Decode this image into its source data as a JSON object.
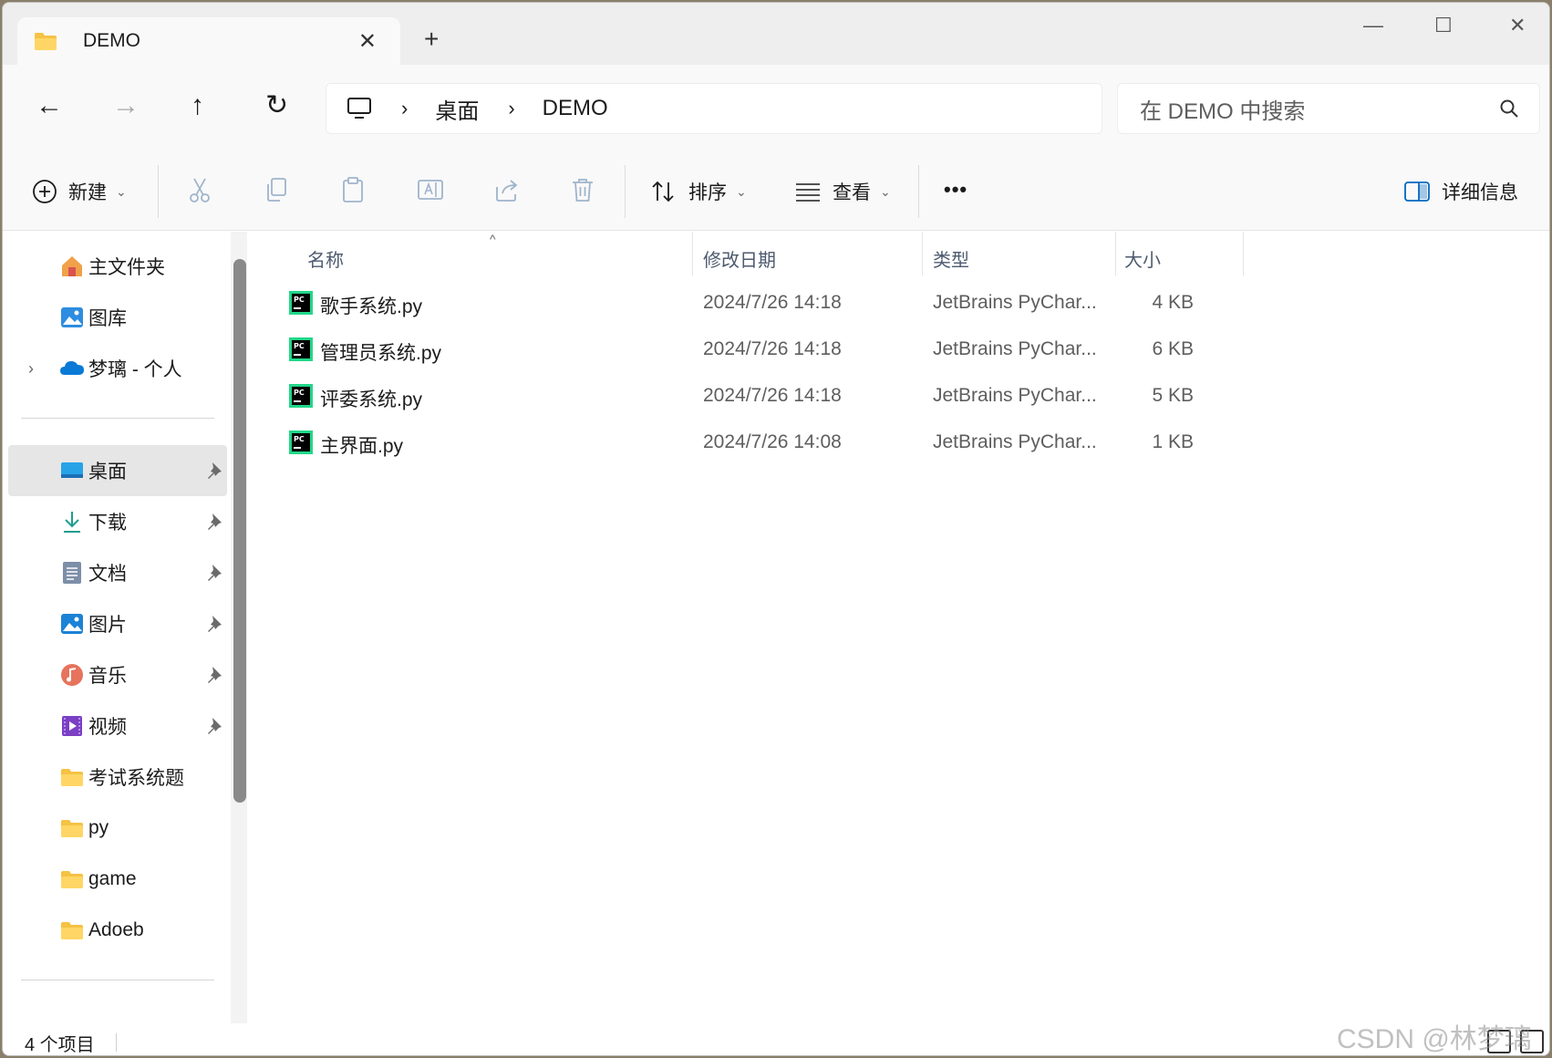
{
  "window": {
    "tab_title": "DEMO",
    "tab_close": "✕",
    "new_tab": "+",
    "minimize": "—",
    "maximize": "☐",
    "close": "✕"
  },
  "nav": {
    "back": "←",
    "forward": "→",
    "up": "↑",
    "refresh": "↻"
  },
  "address": {
    "separator": "›",
    "crumbs": [
      "桌面",
      "DEMO"
    ]
  },
  "search": {
    "placeholder": "在 DEMO 中搜索"
  },
  "toolbar": {
    "new_label": "新建",
    "sort_label": "排序",
    "view_label": "查看",
    "more": "•••",
    "details_label": "详细信息",
    "chevron": "⌄"
  },
  "sidebar": {
    "expander": "›",
    "quick": [
      {
        "label": "主文件夹",
        "icon": "home-icon"
      },
      {
        "label": "图库",
        "icon": "gallery-icon"
      },
      {
        "label": "梦璃 - 个人",
        "icon": "cloud-icon"
      }
    ],
    "pinned": [
      {
        "label": "桌面",
        "icon": "desktop-icon"
      },
      {
        "label": "下载",
        "icon": "download-icon"
      },
      {
        "label": "文档",
        "icon": "document-icon"
      },
      {
        "label": "图片",
        "icon": "pictures-icon"
      },
      {
        "label": "音乐",
        "icon": "music-icon"
      },
      {
        "label": "视频",
        "icon": "video-icon"
      }
    ],
    "folders": [
      "考试系统题",
      "py",
      "game",
      "Adoeb"
    ]
  },
  "table": {
    "columns": [
      "名称",
      "修改日期",
      "类型",
      "大小"
    ],
    "sort_caret": "^",
    "rows": [
      {
        "name": "歌手系统.py",
        "date": "2024/7/26 14:18",
        "type": "JetBrains PyChar...",
        "size": "4 KB"
      },
      {
        "name": "管理员系统.py",
        "date": "2024/7/26 14:18",
        "type": "JetBrains PyChar...",
        "size": "6 KB"
      },
      {
        "name": "评委系统.py",
        "date": "2024/7/26 14:18",
        "type": "JetBrains PyChar...",
        "size": "5 KB"
      },
      {
        "name": "主界面.py",
        "date": "2024/7/26 14:08",
        "type": "JetBrains PyChar...",
        "size": "1 KB"
      }
    ]
  },
  "status": {
    "count": "4 个项目"
  },
  "watermark": "CSDN @林梦璃",
  "colors": {
    "accent": "#0067c0",
    "folder": "#f5c244",
    "selected_bg": "#e6e6e6",
    "pycharm_green": "#21d789"
  }
}
